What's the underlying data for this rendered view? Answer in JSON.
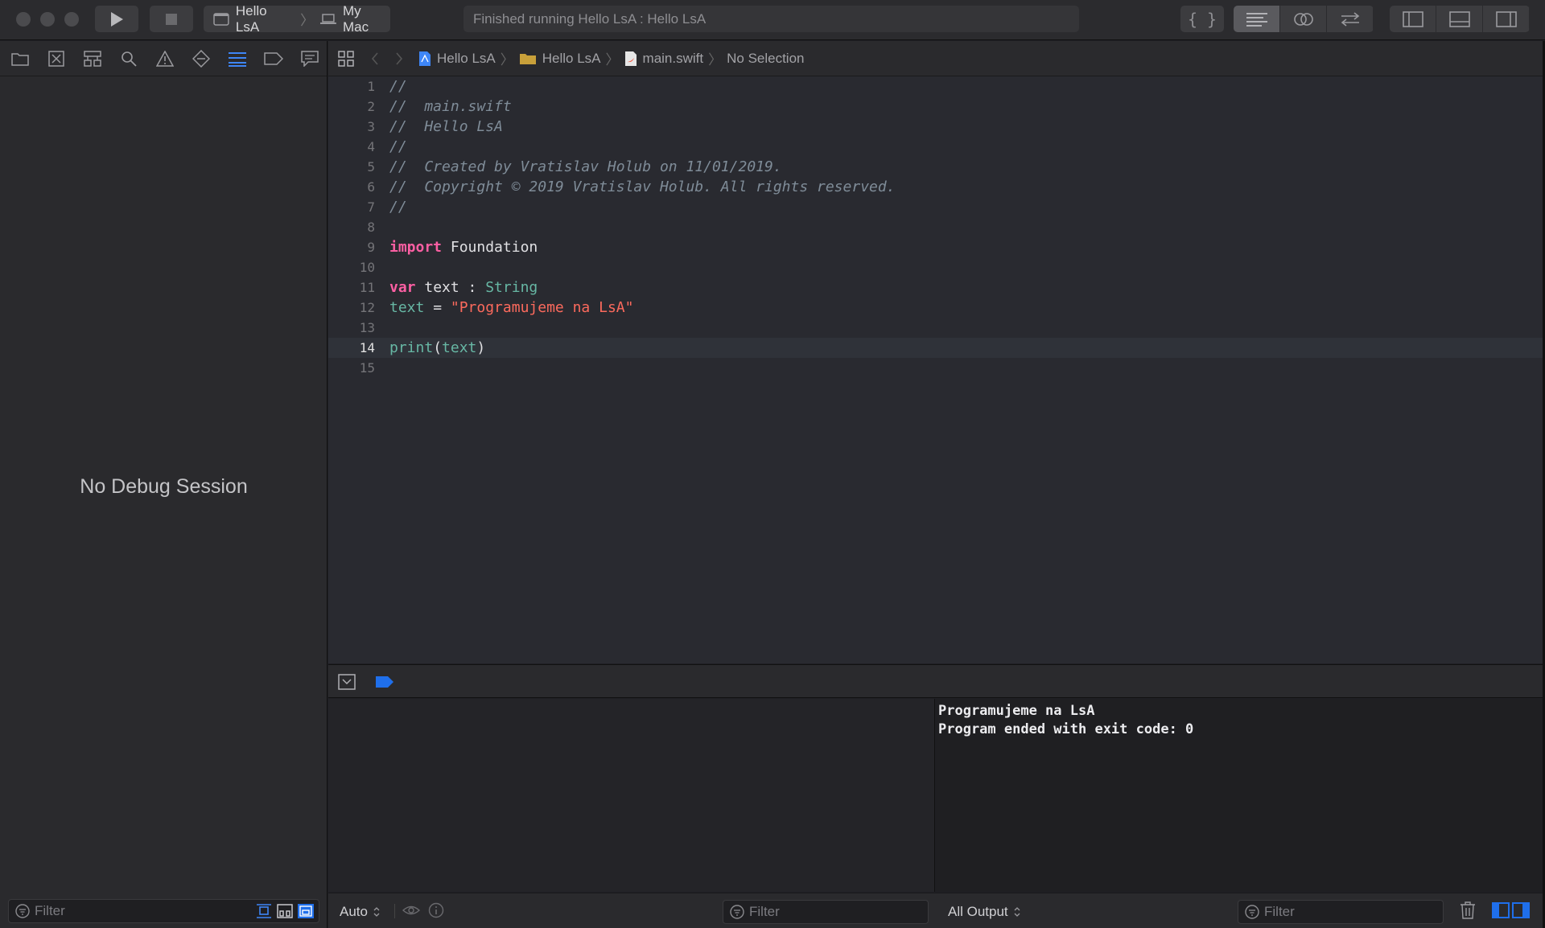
{
  "toolbar": {
    "scheme_target": "Hello LsA",
    "scheme_separator": "〉",
    "scheme_destination": "My Mac",
    "activity_status": "Finished running Hello LsA : Hello LsA",
    "editor_mode_icon": "{ }"
  },
  "navigator": {
    "empty_state": "No Debug Session",
    "filter_placeholder": "Filter"
  },
  "jumpbar": {
    "crumbs": [
      "Hello LsA",
      "Hello LsA",
      "main.swift",
      "No Selection"
    ]
  },
  "editor": {
    "current_line": 14,
    "lines": [
      {
        "n": "1"
      },
      {
        "n": "2"
      },
      {
        "n": "3"
      },
      {
        "n": "4"
      },
      {
        "n": "5"
      },
      {
        "n": "6"
      },
      {
        "n": "7"
      },
      {
        "n": "8"
      },
      {
        "n": "9"
      },
      {
        "n": "10"
      },
      {
        "n": "11"
      },
      {
        "n": "12"
      },
      {
        "n": "13"
      },
      {
        "n": "14"
      },
      {
        "n": "15"
      }
    ],
    "code": {
      "l1": "//",
      "l2": "//  main.swift",
      "l3": "//  Hello LsA",
      "l4": "//",
      "l5": "//  Created by Vratislav Holub on 11/01/2019.",
      "l6": "//  Copyright © 2019 Vratislav Holub. All rights reserved.",
      "l7": "//",
      "l9_kw": "import",
      "l9_mod": " Foundation",
      "l11_kw": "var",
      "l11_name": " text : ",
      "l11_type": "String",
      "l12_var": "text",
      "l12_eq": " = ",
      "l12_str": "\"Programujeme na LsA\"",
      "l14_fn": "print",
      "l14_open": "(",
      "l14_arg": "text",
      "l14_close": ")"
    }
  },
  "console": {
    "output": "Programujeme na LsA\nProgram ended with exit code: 0"
  },
  "debug_bottom": {
    "variables_scope": "Auto",
    "variables_filter_placeholder": "Filter",
    "output_scope": "All Output",
    "console_filter_placeholder": "Filter"
  },
  "colors": {
    "keyword": "#fc5fa3",
    "string": "#fc6a5d",
    "comment": "#7f8c98",
    "type": "#5dd8ff",
    "accent": "#1f6feb"
  }
}
